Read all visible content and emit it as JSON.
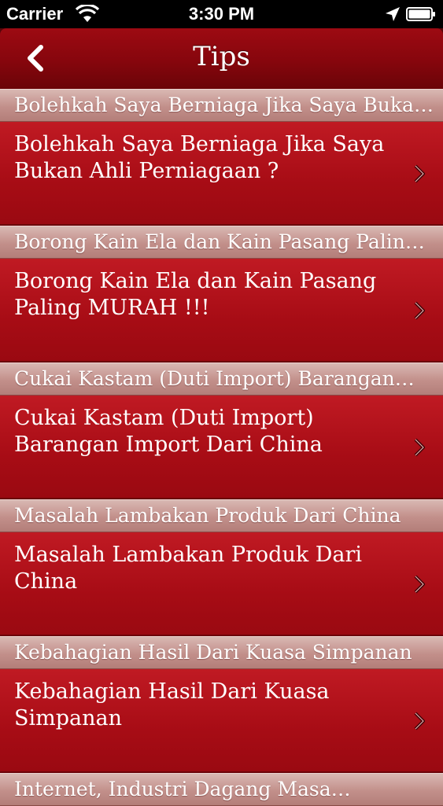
{
  "status_bar": {
    "carrier": "Carrier",
    "time": "3:30 PM",
    "icons": [
      "wifi-icon",
      "location-arrow-icon",
      "battery-icon"
    ]
  },
  "nav": {
    "title": "Tips",
    "back_icon": "back-chevron-icon"
  },
  "colors": {
    "nav_red": "#86060d",
    "cell_red": "#b0121b",
    "header_pink": "#c28f8a"
  },
  "sections": [
    {
      "header": "Bolehkah Saya Berniaga Jika Saya Buka…",
      "item": "Bolehkah Saya Berniaga Jika Saya Bukan Ahli Perniagaan ?"
    },
    {
      "header": "Borong Kain Ela dan Kain Pasang Palin…",
      "item": "Borong Kain Ela dan Kain Pasang Paling MURAH !!!"
    },
    {
      "header": "Cukai Kastam (Duti Import) Barangan…",
      "item": "Cukai Kastam (Duti Import) Barangan Import Dari China"
    },
    {
      "header": "Masalah Lambakan Produk Dari China",
      "item": "Masalah Lambakan Produk Dari China"
    },
    {
      "header": "Kebahagian Hasil Dari Kuasa Simpanan",
      "item": "Kebahagian Hasil Dari Kuasa Simpanan"
    },
    {
      "header": "Internet, Industri Dagang Masa…",
      "item": ""
    }
  ]
}
